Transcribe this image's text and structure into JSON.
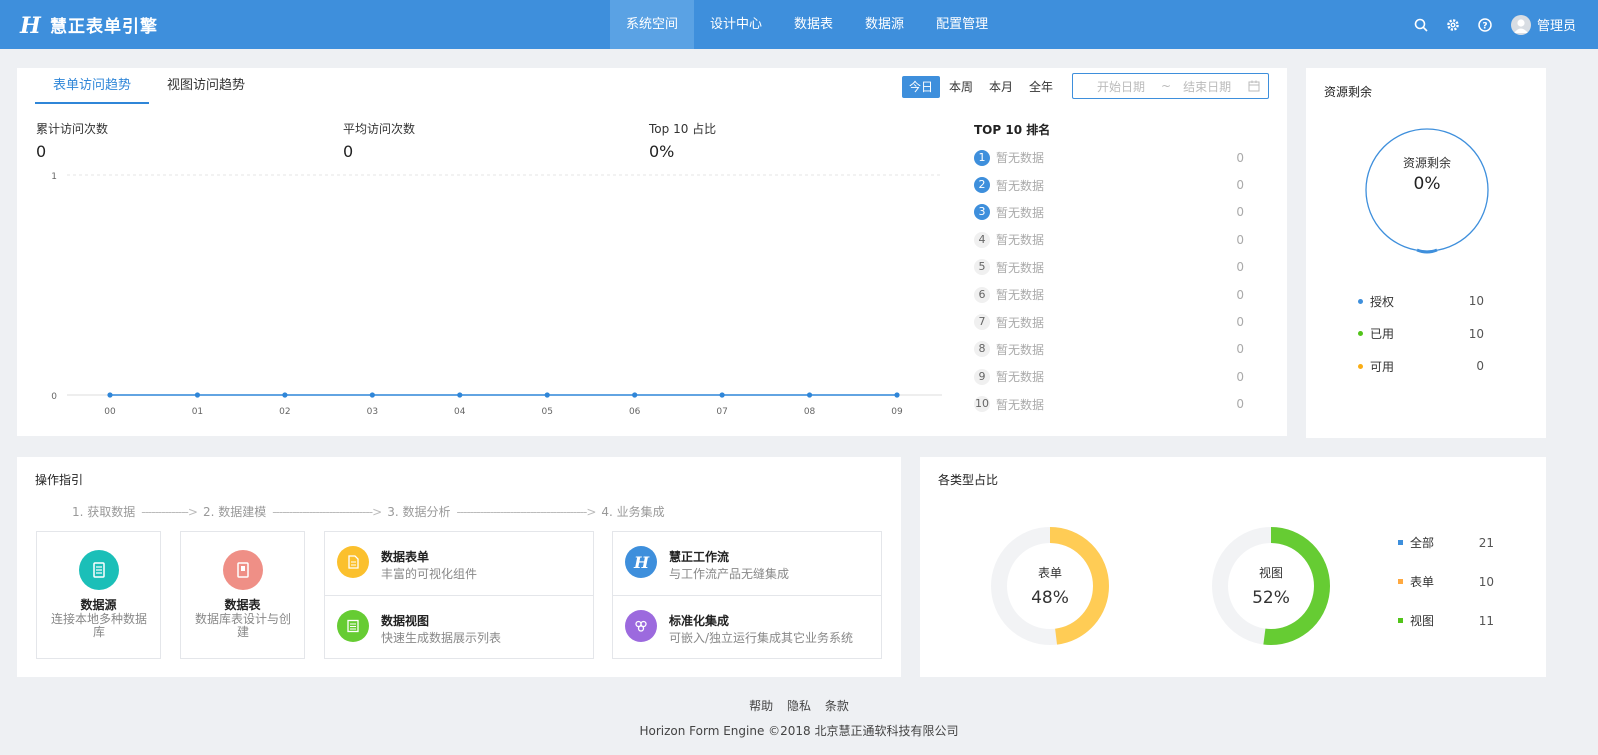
{
  "header": {
    "logo_text": "慧正表单引擎",
    "nav": [
      "系统空间",
      "设计中心",
      "数据表",
      "数据源",
      "配置管理"
    ],
    "active_nav": 0,
    "user_name": "管理员",
    "colors": {
      "bar": "#3e8fdc",
      "active": "#5aa2e4"
    }
  },
  "trend": {
    "tabs": [
      "表单访问趋势",
      "视图访问趋势"
    ],
    "ranges": [
      "今日",
      "本周",
      "本月",
      "全年"
    ],
    "date_start_placeholder": "开始日期",
    "date_separator": "~",
    "date_end_placeholder": "结束日期",
    "stats": [
      {
        "label": "累计访问次数",
        "value": "0"
      },
      {
        "label": "平均访问次数",
        "value": "0"
      },
      {
        "label": "Top 10 占比",
        "value": "0%"
      }
    ],
    "rank_title": "TOP 10 排名",
    "ranks": [
      {
        "num": "1",
        "name": "暂无数据",
        "value": "0"
      },
      {
        "num": "2",
        "name": "暂无数据",
        "value": "0"
      },
      {
        "num": "3",
        "name": "暂无数据",
        "value": "0"
      },
      {
        "num": "4",
        "name": "暂无数据",
        "value": "0"
      },
      {
        "num": "5",
        "name": "暂无数据",
        "value": "0"
      },
      {
        "num": "6",
        "name": "暂无数据",
        "value": "0"
      },
      {
        "num": "7",
        "name": "暂无数据",
        "value": "0"
      },
      {
        "num": "8",
        "name": "暂无数据",
        "value": "0"
      },
      {
        "num": "9",
        "name": "暂无数据",
        "value": "0"
      },
      {
        "num": "10",
        "name": "暂无数据",
        "value": "0"
      }
    ]
  },
  "chart_data": [
    {
      "type": "line",
      "x": [
        "00",
        "01",
        "02",
        "03",
        "04",
        "05",
        "06",
        "07",
        "08",
        "09"
      ],
      "series": [
        {
          "values": [
            0,
            0,
            0,
            0,
            0,
            0,
            0,
            0,
            0,
            0
          ]
        }
      ],
      "yticks": [
        "0",
        "1"
      ],
      "ylim": [
        0,
        1
      ],
      "grid": true,
      "color": "#2f86d8"
    },
    {
      "type": "pie",
      "title": "资源剩余",
      "center_label": "资源剩余",
      "center_value": "0%",
      "percent": 0,
      "legend": [
        {
          "label": "授权",
          "value": "10",
          "color": "#3e8fdc"
        },
        {
          "label": "已用",
          "value": "10",
          "color": "#52c41a"
        },
        {
          "label": "可用",
          "value": "0",
          "color": "#faad14"
        }
      ]
    },
    {
      "type": "pie",
      "title": "各类型占比",
      "donuts": [
        {
          "label": "表单",
          "value": "48%",
          "percent": 48,
          "color": "#ffcc55"
        },
        {
          "label": "视图",
          "value": "52%",
          "percent": 52,
          "color": "#66cc33"
        }
      ],
      "legend": [
        {
          "label": "全部",
          "value": "21",
          "color": "#3e8fdc"
        },
        {
          "label": "表单",
          "value": "10",
          "color": "#ffa940"
        },
        {
          "label": "视图",
          "value": "11",
          "color": "#52c41a"
        }
      ]
    }
  ],
  "guide": {
    "title": "操作指引",
    "steps": [
      "1. 获取数据",
      "2. 数据建模",
      "3. 数据分析",
      "4. 业务集成"
    ],
    "step_arrows": [
      "-------------->",
      "------------------------------>",
      "--------------------------------------->"
    ],
    "small_cards": [
      {
        "name": "数据源",
        "desc": "连接本地多种数据库",
        "icon": "database-icon",
        "color": "#1bbfb8"
      },
      {
        "name": "数据表",
        "desc": "数据库表设计与创建",
        "icon": "table-icon",
        "color": "#ef8f86"
      }
    ],
    "wide_cards": [
      [
        {
          "name": "数据表单",
          "desc": "丰富的可视化组件",
          "icon": "form-icon",
          "color": "#fbc02d"
        },
        {
          "name": "数据视图",
          "desc": "快速生成数据展示列表",
          "icon": "list-icon",
          "color": "#66cc33"
        }
      ],
      [
        {
          "name": "慧正工作流",
          "desc": "与工作流产品无缝集成",
          "icon": "workflow-logo-icon",
          "color": "#3e8fdc"
        },
        {
          "name": "标准化集成",
          "desc": "可嵌入/独立运行集成其它业务系统",
          "icon": "integration-icon",
          "color": "#9c6ade"
        }
      ]
    ]
  },
  "footer": {
    "links": [
      "帮助",
      "隐私",
      "条款"
    ],
    "copyright": "Horizon Form Engine ©2018 北京慧正通软科技有限公司"
  }
}
